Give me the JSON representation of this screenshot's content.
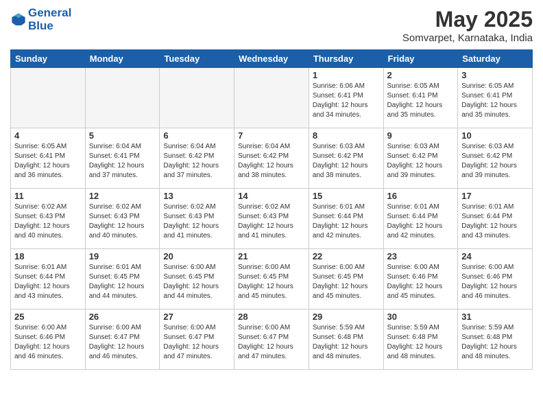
{
  "logo": {
    "line1": "General",
    "line2": "Blue"
  },
  "title": "May 2025",
  "subtitle": "Somvarpet, Karnataka, India",
  "headers": [
    "Sunday",
    "Monday",
    "Tuesday",
    "Wednesday",
    "Thursday",
    "Friday",
    "Saturday"
  ],
  "weeks": [
    [
      {
        "day": "",
        "info": ""
      },
      {
        "day": "",
        "info": ""
      },
      {
        "day": "",
        "info": ""
      },
      {
        "day": "",
        "info": ""
      },
      {
        "day": "1",
        "info": "Sunrise: 6:06 AM\nSunset: 6:41 PM\nDaylight: 12 hours\nand 34 minutes."
      },
      {
        "day": "2",
        "info": "Sunrise: 6:05 AM\nSunset: 6:41 PM\nDaylight: 12 hours\nand 35 minutes."
      },
      {
        "day": "3",
        "info": "Sunrise: 6:05 AM\nSunset: 6:41 PM\nDaylight: 12 hours\nand 35 minutes."
      }
    ],
    [
      {
        "day": "4",
        "info": "Sunrise: 6:05 AM\nSunset: 6:41 PM\nDaylight: 12 hours\nand 36 minutes."
      },
      {
        "day": "5",
        "info": "Sunrise: 6:04 AM\nSunset: 6:41 PM\nDaylight: 12 hours\nand 37 minutes."
      },
      {
        "day": "6",
        "info": "Sunrise: 6:04 AM\nSunset: 6:42 PM\nDaylight: 12 hours\nand 37 minutes."
      },
      {
        "day": "7",
        "info": "Sunrise: 6:04 AM\nSunset: 6:42 PM\nDaylight: 12 hours\nand 38 minutes."
      },
      {
        "day": "8",
        "info": "Sunrise: 6:03 AM\nSunset: 6:42 PM\nDaylight: 12 hours\nand 38 minutes."
      },
      {
        "day": "9",
        "info": "Sunrise: 6:03 AM\nSunset: 6:42 PM\nDaylight: 12 hours\nand 39 minutes."
      },
      {
        "day": "10",
        "info": "Sunrise: 6:03 AM\nSunset: 6:42 PM\nDaylight: 12 hours\nand 39 minutes."
      }
    ],
    [
      {
        "day": "11",
        "info": "Sunrise: 6:02 AM\nSunset: 6:43 PM\nDaylight: 12 hours\nand 40 minutes."
      },
      {
        "day": "12",
        "info": "Sunrise: 6:02 AM\nSunset: 6:43 PM\nDaylight: 12 hours\nand 40 minutes."
      },
      {
        "day": "13",
        "info": "Sunrise: 6:02 AM\nSunset: 6:43 PM\nDaylight: 12 hours\nand 41 minutes."
      },
      {
        "day": "14",
        "info": "Sunrise: 6:02 AM\nSunset: 6:43 PM\nDaylight: 12 hours\nand 41 minutes."
      },
      {
        "day": "15",
        "info": "Sunrise: 6:01 AM\nSunset: 6:44 PM\nDaylight: 12 hours\nand 42 minutes."
      },
      {
        "day": "16",
        "info": "Sunrise: 6:01 AM\nSunset: 6:44 PM\nDaylight: 12 hours\nand 42 minutes."
      },
      {
        "day": "17",
        "info": "Sunrise: 6:01 AM\nSunset: 6:44 PM\nDaylight: 12 hours\nand 43 minutes."
      }
    ],
    [
      {
        "day": "18",
        "info": "Sunrise: 6:01 AM\nSunset: 6:44 PM\nDaylight: 12 hours\nand 43 minutes."
      },
      {
        "day": "19",
        "info": "Sunrise: 6:01 AM\nSunset: 6:45 PM\nDaylight: 12 hours\nand 44 minutes."
      },
      {
        "day": "20",
        "info": "Sunrise: 6:00 AM\nSunset: 6:45 PM\nDaylight: 12 hours\nand 44 minutes."
      },
      {
        "day": "21",
        "info": "Sunrise: 6:00 AM\nSunset: 6:45 PM\nDaylight: 12 hours\nand 45 minutes."
      },
      {
        "day": "22",
        "info": "Sunrise: 6:00 AM\nSunset: 6:45 PM\nDaylight: 12 hours\nand 45 minutes."
      },
      {
        "day": "23",
        "info": "Sunrise: 6:00 AM\nSunset: 6:46 PM\nDaylight: 12 hours\nand 45 minutes."
      },
      {
        "day": "24",
        "info": "Sunrise: 6:00 AM\nSunset: 6:46 PM\nDaylight: 12 hours\nand 46 minutes."
      }
    ],
    [
      {
        "day": "25",
        "info": "Sunrise: 6:00 AM\nSunset: 6:46 PM\nDaylight: 12 hours\nand 46 minutes."
      },
      {
        "day": "26",
        "info": "Sunrise: 6:00 AM\nSunset: 6:47 PM\nDaylight: 12 hours\nand 46 minutes."
      },
      {
        "day": "27",
        "info": "Sunrise: 6:00 AM\nSunset: 6:47 PM\nDaylight: 12 hours\nand 47 minutes."
      },
      {
        "day": "28",
        "info": "Sunrise: 6:00 AM\nSunset: 6:47 PM\nDaylight: 12 hours\nand 47 minutes."
      },
      {
        "day": "29",
        "info": "Sunrise: 5:59 AM\nSunset: 6:48 PM\nDaylight: 12 hours\nand 48 minutes."
      },
      {
        "day": "30",
        "info": "Sunrise: 5:59 AM\nSunset: 6:48 PM\nDaylight: 12 hours\nand 48 minutes."
      },
      {
        "day": "31",
        "info": "Sunrise: 5:59 AM\nSunset: 6:48 PM\nDaylight: 12 hours\nand 48 minutes."
      }
    ]
  ]
}
